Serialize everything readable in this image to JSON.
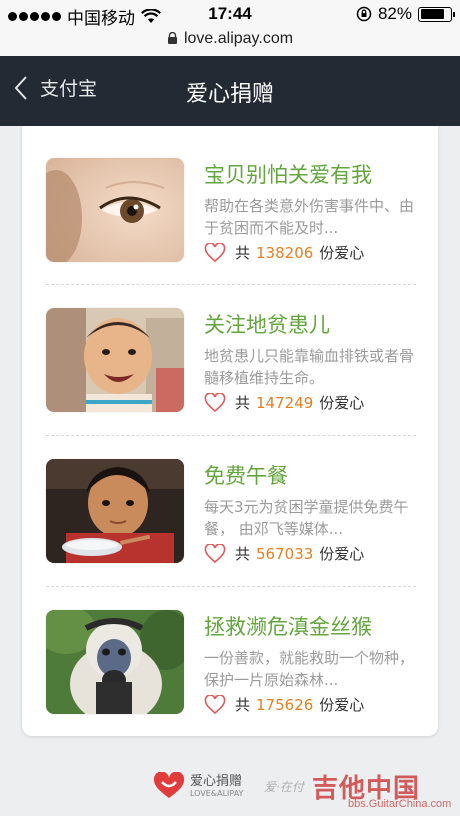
{
  "status_bar": {
    "carrier": "中国移动",
    "time": "17:44",
    "battery": "82%",
    "battery_level": 0.82
  },
  "url_bar": {
    "url": "love.alipay.com"
  },
  "nav": {
    "back_label": "支付宝",
    "title": "爱心捐赠"
  },
  "items": [
    {
      "name": "宝贝别怕关爱有我",
      "desc": "帮助在各类意外伤害事件中、由于贫困而不能及时...",
      "count_prefix": "共",
      "count": "138206",
      "count_suffix": "份爱心"
    },
    {
      "name": "关注地贫患儿",
      "desc": "地贫患儿只能靠输血排铁或者骨髓移植维持生命。",
      "count_prefix": "共",
      "count": "147249",
      "count_suffix": "份爱心"
    },
    {
      "name": "免费午餐",
      "desc": "每天3元为贫困学童提供免费午餐， 由邓飞等媒体...",
      "count_prefix": "共",
      "count": "567033",
      "count_suffix": "份爱心"
    },
    {
      "name": "拯救濒危滇金丝猴",
      "desc": "一份善款，就能救助一个物种，保护一片原始森林...",
      "count_prefix": "共",
      "count": "175626",
      "count_suffix": "份爱心"
    }
  ],
  "footer": {
    "logo_text": "爱心捐赠",
    "logo_sub": "LOVE&ALIPAY",
    "watermark_mid": "爱·在付",
    "watermark_brand": "吉他中国",
    "watermark_url": "bbs.GuitarChina.com"
  },
  "colors": {
    "nav_bg": "#232a33",
    "title_green": "#63a63d",
    "count_orange": "#e67e22",
    "heart_red": "#e05a5a"
  }
}
